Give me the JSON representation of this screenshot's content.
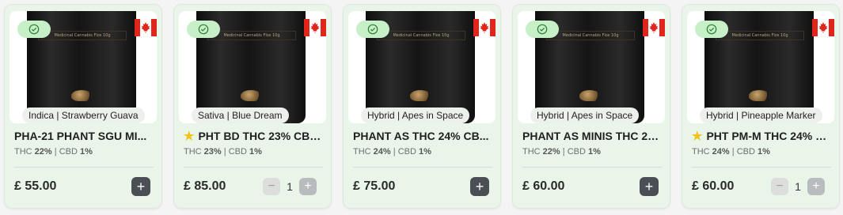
{
  "cards": [
    {
      "tag": "Indica | Strawberry Guava",
      "title": "PHA-21 PHANT SGU MI...",
      "star": "",
      "thc": "22%",
      "cbd": "1%",
      "price": "£ 55.00",
      "qty": ""
    },
    {
      "tag": "Sativa | Blue Dream",
      "title": "PHT BD THC 23% CBD...",
      "star": "★",
      "thc": "23%",
      "cbd": "1%",
      "price": "£ 85.00",
      "qty": "1"
    },
    {
      "tag": "Hybrid | Apes in Space",
      "title": "PHANT AS THC 24% CB...",
      "star": "",
      "thc": "24%",
      "cbd": "1%",
      "price": "£ 75.00",
      "qty": ""
    },
    {
      "tag": "Hybrid | Apes in Space",
      "title": "PHANT AS MINIS THC 22...",
      "star": "",
      "thc": "22%",
      "cbd": "1%",
      "price": "£ 60.00",
      "qty": ""
    },
    {
      "tag": "Hybrid | Pineapple Marker",
      "title": "PHT PM-M THC 24% C...",
      "star": "★",
      "thc": "24%",
      "cbd": "1%",
      "price": "£ 60.00",
      "qty": "1"
    }
  ],
  "labels": {
    "thc": "THC",
    "cbd": "CBD",
    "sep": "|",
    "bag_text": "Medicinal Cannabis Flos 10g",
    "minus": "−",
    "plus": "+"
  },
  "colors": {
    "card_bg": "#eaf5ea",
    "check_pill": "#c7f0c9",
    "flag_red": "#e1251b",
    "add_button": "#4a4f55",
    "star": "#f2c21b"
  }
}
